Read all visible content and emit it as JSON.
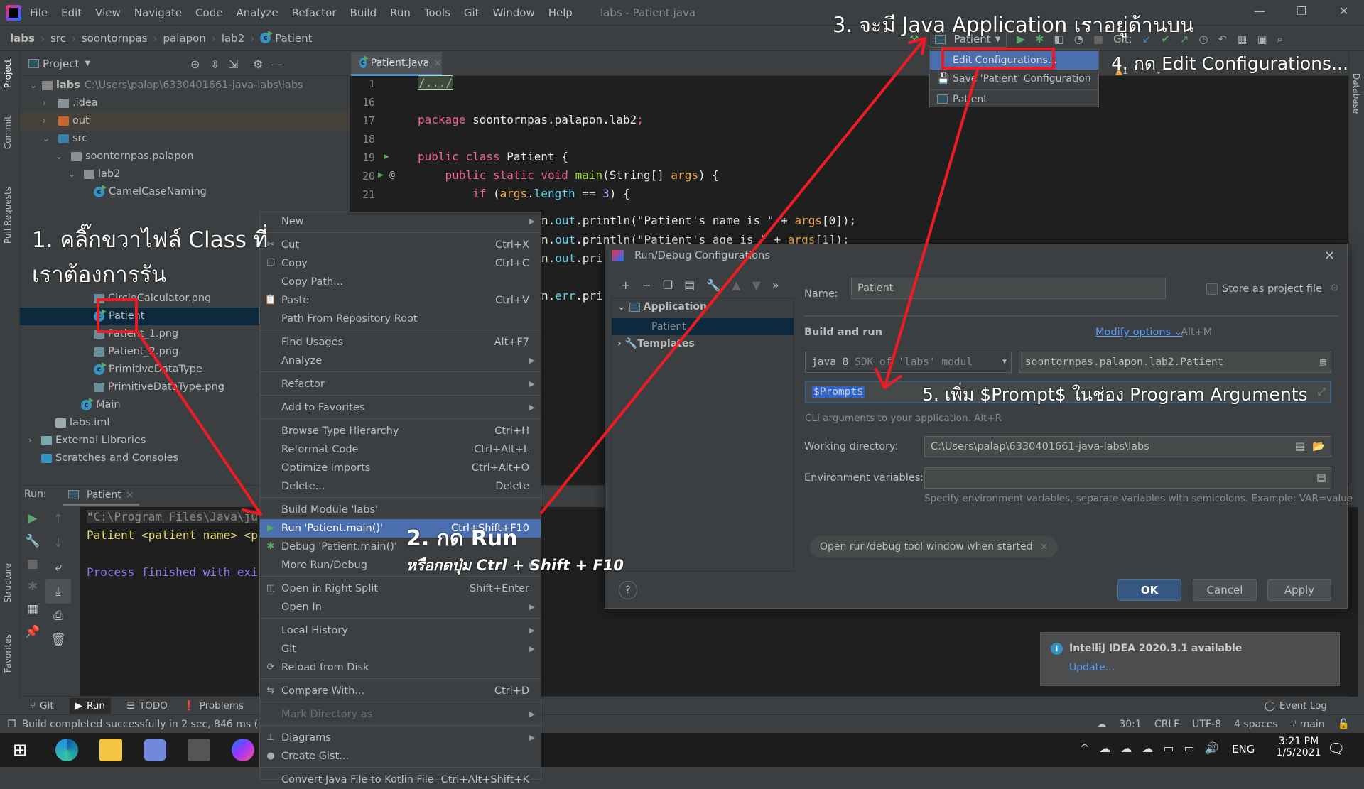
{
  "menubar": {
    "items": [
      "File",
      "Edit",
      "View",
      "Navigate",
      "Code",
      "Analyze",
      "Refactor",
      "Build",
      "Run",
      "Tools",
      "Git",
      "Window",
      "Help"
    ],
    "window_title": "labs - Patient.java"
  },
  "breadcrumbs": [
    "labs",
    "src",
    "soontornpas",
    "palapon",
    "lab2",
    "Patient"
  ],
  "toolbar": {
    "run_config": "Patient",
    "git_label": "Git:"
  },
  "run_config_dropdown": {
    "items": [
      "Edit Configurations...",
      "Save 'Patient' Configuration",
      "Patient"
    ]
  },
  "left_strip": [
    "Project",
    "Commit",
    "Pull Requests",
    "Structure",
    "Favorites"
  ],
  "right_strip": [
    "Database"
  ],
  "project": {
    "title": "Project",
    "tree": [
      {
        "label": "labs",
        "path": "C:\\Users\\palap\\6330401661-java-labs\\labs",
        "type": "module",
        "expanded": true
      },
      {
        "label": ".idea",
        "type": "folder",
        "expanded": false
      },
      {
        "label": "out",
        "type": "folder-out",
        "expanded": false
      },
      {
        "label": "src",
        "type": "folder-src",
        "expanded": true
      },
      {
        "label": "soontornpas.palapon",
        "type": "package",
        "expanded": true
      },
      {
        "label": "lab2",
        "type": "package",
        "expanded": true
      },
      {
        "label": "CamelCaseNaming",
        "type": "class"
      },
      {
        "label": "CircleCalculator.png",
        "type": "image"
      },
      {
        "label": "Patient",
        "type": "class",
        "selected": true
      },
      {
        "label": "Patient_1.png",
        "type": "image"
      },
      {
        "label": "Patient_2.png",
        "type": "image"
      },
      {
        "label": "PrimitiveDataType",
        "type": "class"
      },
      {
        "label": "PrimitiveDataType.png",
        "type": "image"
      },
      {
        "label": "Main",
        "type": "class"
      },
      {
        "label": "labs.iml",
        "type": "iml"
      },
      {
        "label": "External Libraries",
        "type": "libs",
        "expanded": false
      },
      {
        "label": "Scratches and Consoles",
        "type": "scratch"
      }
    ]
  },
  "editor": {
    "tab": "Patient.java",
    "warnings": "1",
    "lines": [
      {
        "n": "1",
        "tokens": [
          {
            "t": "/.../",
            "k": "fold"
          }
        ]
      },
      {
        "n": "16",
        "tokens": []
      },
      {
        "n": "17",
        "tokens": [
          {
            "t": "package ",
            "k": "kw"
          },
          {
            "t": "soontornpas.palapon.lab2",
            "k": "id"
          },
          {
            "t": ";",
            "k": "kw"
          }
        ]
      },
      {
        "n": "18",
        "tokens": []
      },
      {
        "n": "19",
        "tokens": [
          {
            "t": "public class ",
            "k": "kw"
          },
          {
            "t": "Patient {",
            "k": "id"
          }
        ]
      },
      {
        "n": "20",
        "tokens": [
          {
            "t": "    public static void ",
            "k": "kw"
          },
          {
            "t": "main",
            "k": "fn"
          },
          {
            "t": "(String[] ",
            "k": "id"
          },
          {
            "t": "args",
            "k": "arg"
          },
          {
            "t": ") {",
            "k": "id"
          }
        ]
      },
      {
        "n": "21",
        "tokens": [
          {
            "t": "        if ",
            "k": "kw"
          },
          {
            "t": "(",
            "k": "id"
          },
          {
            "t": "args",
            "k": "arg"
          },
          {
            "t": ".",
            "k": "id"
          },
          {
            "t": "length",
            "k": "fld"
          },
          {
            "t": " == ",
            "k": "id"
          },
          {
            "t": "3",
            "k": "num"
          },
          {
            "t": ") {",
            "k": "id"
          }
        ]
      }
    ],
    "partial_lines": [
      [
        {
          "t": "n.",
          "k": "id"
        },
        {
          "t": "out",
          "k": "fld"
        },
        {
          "t": ".println(\"Patient's name is \" + ",
          "k": "id"
        },
        {
          "t": "args",
          "k": "arg"
        },
        {
          "t": "[0]);",
          "k": "id"
        }
      ],
      [
        {
          "t": "n.",
          "k": "id"
        },
        {
          "t": "out",
          "k": "fld"
        },
        {
          "t": ".println(\"Patient's age is \" + ",
          "k": "id"
        },
        {
          "t": "args",
          "k": "arg"
        },
        {
          "t": "[1]);",
          "k": "id"
        }
      ],
      [
        {
          "t": "n.",
          "k": "id"
        },
        {
          "t": "out",
          "k": "fld"
        },
        {
          "t": ".pri",
          "k": "id"
        }
      ],
      [
        {
          "t": "n.",
          "k": "id"
        },
        {
          "t": "err",
          "k": "fld"
        },
        {
          "t": ".pri",
          "k": "id"
        }
      ]
    ]
  },
  "run": {
    "label": "Run:",
    "tab": "Patient",
    "console": [
      "\"C:\\Program Files\\Java\\ju",
      "Patient <patient name> <p",
      "",
      "Process finished with exi"
    ]
  },
  "bottom_tabs": [
    "Git",
    "Run",
    "TODO",
    "Problems"
  ],
  "status": {
    "message": "Build completed successfully in 2 sec, 846 ms (a m",
    "position": "30:1",
    "line_sep": "CRLF",
    "encoding": "UTF-8",
    "indent": "4 spaces",
    "branch": "main",
    "event_log": "Event Log"
  },
  "taskbar": {
    "lang": "ENG",
    "time": "3:21 PM",
    "date": "1/5/2021"
  },
  "context_menu": [
    {
      "label": "New",
      "sub": true
    },
    {
      "sep": true
    },
    {
      "label": "Cut",
      "sc": "Ctrl+X",
      "icon": "✂"
    },
    {
      "label": "Copy",
      "sc": "Ctrl+C",
      "icon": "❐"
    },
    {
      "label": "Copy Path..."
    },
    {
      "label": "Paste",
      "sc": "Ctrl+V",
      "icon": "📋"
    },
    {
      "label": "Path From Repository Root"
    },
    {
      "sep": true
    },
    {
      "label": "Find Usages",
      "sc": "Alt+F7"
    },
    {
      "label": "Analyze",
      "sub": true
    },
    {
      "sep": true
    },
    {
      "label": "Refactor",
      "sub": true
    },
    {
      "sep": true
    },
    {
      "label": "Add to Favorites",
      "sub": true
    },
    {
      "sep": true
    },
    {
      "label": "Browse Type Hierarchy",
      "sc": "Ctrl+H"
    },
    {
      "label": "Reformat Code",
      "sc": "Ctrl+Alt+L"
    },
    {
      "label": "Optimize Imports",
      "sc": "Ctrl+Alt+O"
    },
    {
      "label": "Delete...",
      "sc": "Delete"
    },
    {
      "sep": true
    },
    {
      "label": "Build Module 'labs'"
    },
    {
      "label": "Run 'Patient.main()'",
      "sc": "Ctrl+Shift+F10",
      "icon": "▶",
      "selected": true
    },
    {
      "label": "Debug 'Patient.main()'",
      "icon": "✱"
    },
    {
      "label": "More Run/Debug",
      "sub": true
    },
    {
      "sep": true
    },
    {
      "label": "Open in Right Split",
      "sc": "Shift+Enter",
      "icon": "◫"
    },
    {
      "label": "Open In",
      "sub": true
    },
    {
      "sep": true
    },
    {
      "label": "Local History",
      "sub": true
    },
    {
      "label": "Git",
      "sub": true
    },
    {
      "label": "Reload from Disk",
      "icon": "⟳"
    },
    {
      "sep": true
    },
    {
      "label": "Compare With...",
      "sc": "Ctrl+D",
      "icon": "⇆"
    },
    {
      "sep": true
    },
    {
      "label": "Mark Directory as",
      "sub": true,
      "disabled": true
    },
    {
      "sep": true
    },
    {
      "label": "Diagrams",
      "sub": true,
      "icon": "⊥"
    },
    {
      "label": "Create Gist...",
      "icon": "●"
    },
    {
      "sep": true
    },
    {
      "label": "Convert Java File to Kotlin File",
      "sc": "Ctrl+Alt+Shift+K"
    }
  ],
  "dialog": {
    "title": "Run/Debug Configurations",
    "tree": {
      "group": "Application",
      "item": "Patient",
      "templates": "Templates"
    },
    "name_label": "Name:",
    "name_value": "Patient",
    "store_label": "Store as project file",
    "section": "Build and run",
    "modify_options": "Modify options",
    "modify_shortcut": "Alt+M",
    "sdk": "java 8",
    "sdk_hint": "SDK of 'labs' modul",
    "main_class": "soontornpas.palapon.lab2.Patient",
    "program_args": "$Prompt$",
    "args_hint": "CLI arguments to your application. Alt+R",
    "workdir_label": "Working directory:",
    "workdir_value": "C:\\Users\\palap\\6330401661-java-labs\\labs",
    "env_label": "Environment variables:",
    "env_value": "",
    "env_hint": "Specify environment variables, separate variables with semicolons. Example: VAR=value",
    "chip": "Open run/debug tool window when started",
    "ok": "OK",
    "cancel": "Cancel",
    "apply": "Apply",
    "help": "?"
  },
  "notification": {
    "title": "IntelliJ IDEA 2020.3.1 available",
    "link": "Update..."
  },
  "annotations": {
    "step1a": "1. คลิ๊กขวาไฟล์ Class ที่",
    "step1b": "เราต้องการรัน",
    "step2": "2. กด Run",
    "step2b": "หรือกดปุ่ม Ctrl + Shift + F10",
    "step3": "3. จะมี Java Application เราอยู่ด้านบน",
    "step4": "4. กด Edit Configurations...",
    "step5": "5. เพิ่ม $Prompt$ ในช่อง Program Arguments",
    "color": "#ed1c24"
  }
}
